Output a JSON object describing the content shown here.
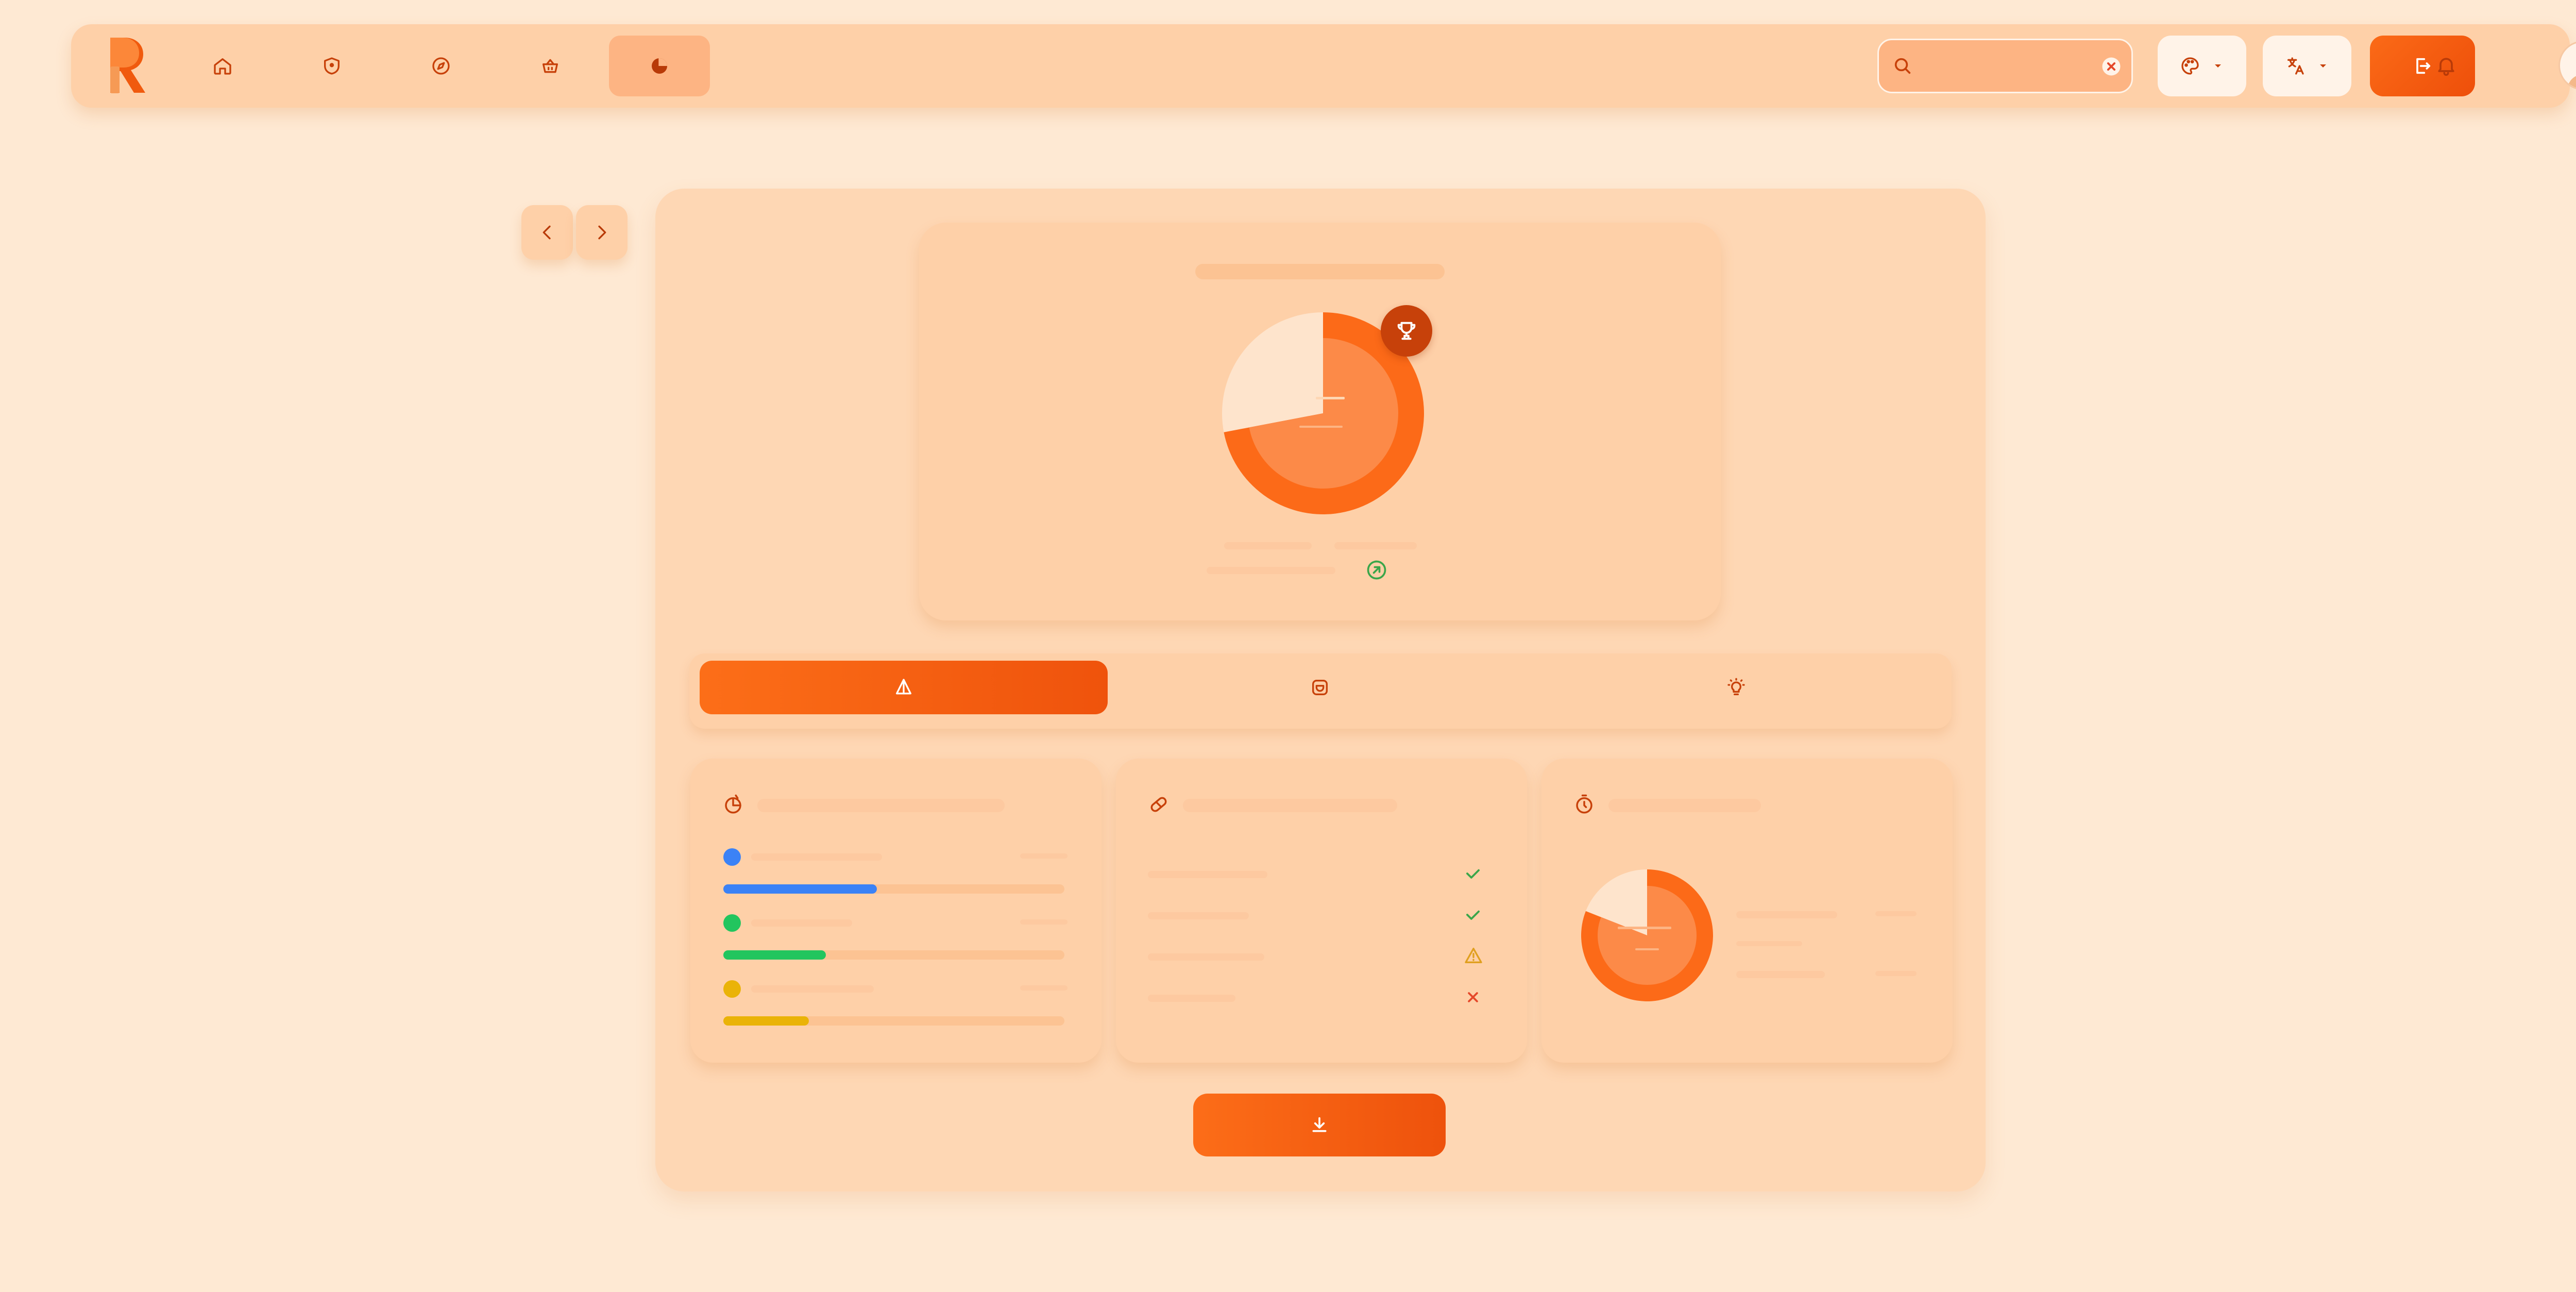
{
  "colors": {
    "background": "#fee9d3",
    "surface": "#fed0a8",
    "accent": "#fb6a17",
    "accent_dark": "#c7410a",
    "blue": "#3b82f6",
    "green": "#22c55e",
    "yellow": "#eab308",
    "warning": "#e0a020",
    "error": "#e5482a",
    "success": "#3aa64a"
  },
  "nav": {
    "items": [
      {
        "icon": "home-icon"
      },
      {
        "icon": "shield-icon"
      },
      {
        "icon": "compass-icon"
      },
      {
        "icon": "basket-icon"
      },
      {
        "icon": "pie-chart-icon",
        "active": true
      }
    ]
  },
  "search": {
    "placeholder": "",
    "value": ""
  },
  "score": {
    "primary_share": 0.72,
    "inner_fill_share": 0.72
  },
  "tabs": [
    {
      "icon": "pyramid-icon",
      "active": true
    },
    {
      "icon": "camera-box-icon",
      "active": false
    },
    {
      "icon": "bulb-icon",
      "active": false
    }
  ],
  "breakdown": {
    "bars": [
      {
        "color": "#3b82f6",
        "progress": 0.45
      },
      {
        "color": "#22c55e",
        "progress": 0.3
      },
      {
        "color": "#eab308",
        "progress": 0.25
      }
    ]
  },
  "checks": {
    "rows": [
      {
        "status": "success",
        "icon": "check-icon"
      },
      {
        "status": "success",
        "icon": "check-icon"
      },
      {
        "status": "warning",
        "icon": "warning-icon"
      },
      {
        "status": "error",
        "icon": "x-icon"
      }
    ]
  },
  "mini_donut": {
    "share": 0.81
  }
}
